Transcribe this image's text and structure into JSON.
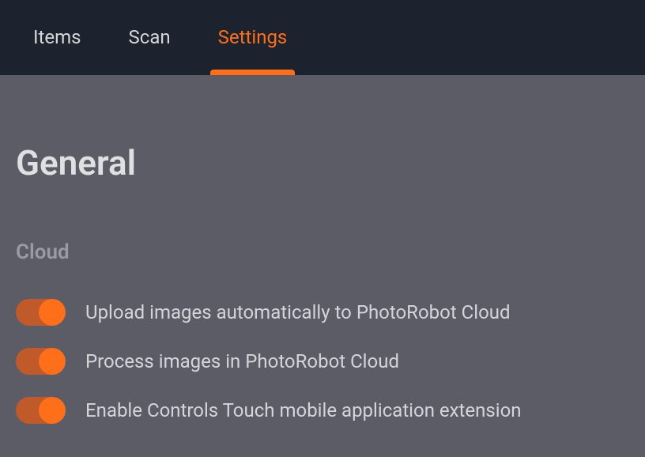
{
  "tabs": {
    "items": "Items",
    "scan": "Scan",
    "settings": "Settings"
  },
  "page_title": "General",
  "section": {
    "cloud_title": "Cloud",
    "toggles": {
      "upload": {
        "label": "Upload images automatically to PhotoRobot Cloud",
        "on": true
      },
      "process": {
        "label": "Process images in PhotoRobot Cloud",
        "on": true
      },
      "touch": {
        "label": "Enable Controls Touch mobile application extension",
        "on": true
      }
    }
  }
}
